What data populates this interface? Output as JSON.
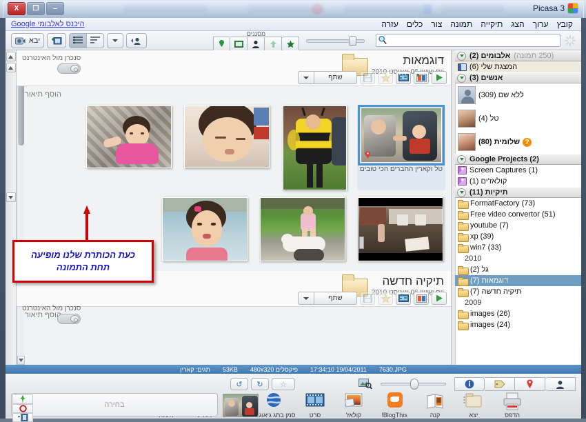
{
  "window": {
    "title": "Picasa 3",
    "buttons": {
      "close": "X",
      "maximize": "❐",
      "minimize": "–"
    }
  },
  "menubar": {
    "items": [
      "קובץ",
      "ערוך",
      "הצג",
      "תיקייה",
      "תמונה",
      "צור",
      "כלים",
      "עזרה"
    ],
    "google_link": "היכנס לאלבומי Google"
  },
  "toolbar": {
    "search_placeholder": "",
    "search_value": "",
    "filters_label": "מסננים",
    "filters": [
      "geotag-filter",
      "video-filter",
      "faces-filter",
      "upload-filter",
      "star-filter"
    ],
    "import_label": "יבא",
    "zoom_value": 72
  },
  "sidebar": {
    "groups": [
      {
        "title": "אלבומים (2)",
        "dim": "(250 תמונה)",
        "items": [
          {
            "label": "המצגת שלי (6)",
            "icon": "book-icon",
            "style": "alt"
          }
        ]
      },
      {
        "title": "אנשים (3)",
        "dim": "",
        "items": [
          {
            "label": "ללא שם (309)",
            "icon": "avatar-generic",
            "style": "person"
          },
          {
            "label": "טל (4)",
            "icon": "avatar-photo",
            "style": "person"
          },
          {
            "label": "שלומית (80)",
            "icon": "avatar-photo",
            "style": "person",
            "badge": "?"
          }
        ]
      },
      {
        "title": "Google Projects (2)",
        "dim": "",
        "items": [
          {
            "label": "Screen Captures (1)",
            "icon": "album-icon"
          },
          {
            "label": "קולאז'ים (1)",
            "icon": "album-icon"
          }
        ]
      },
      {
        "title": "תיקיות (11)",
        "dim": "",
        "items": [
          {
            "label": "FormatFactory (73)",
            "icon": "folder-icon"
          },
          {
            "label": "Free video convertor (51)",
            "icon": "folder-icon"
          },
          {
            "label": "youtube (7)",
            "icon": "folder-icon"
          },
          {
            "label": "xp (39)",
            "icon": "folder-icon"
          },
          {
            "label": "win7 (33)",
            "icon": "folder-icon"
          },
          {
            "label": "2010",
            "icon": "year-label",
            "style": "year"
          },
          {
            "label": "גל (2)",
            "icon": "folder-icon"
          },
          {
            "label": "דוגמאות (7)",
            "icon": "folder-icon",
            "style": "selected"
          },
          {
            "label": "תיקיה חדשה (7)",
            "icon": "folder-icon"
          },
          {
            "label": "2009",
            "icon": "year-label",
            "style": "year"
          },
          {
            "label": "images (26)",
            "icon": "folder-icon"
          },
          {
            "label": "images (24)",
            "icon": "folder-icon"
          }
        ]
      }
    ]
  },
  "albums": [
    {
      "name": "דוגמאות",
      "date": "יום שישי 06 אוגוסט 2010",
      "share_label": "שתף",
      "description_placeholder": "הוסף תיאור",
      "sync_label": "סנכרן מול האינטרנט",
      "photos": [
        {
          "caption": "טל וקארין החברים הכי טובים",
          "selected": true,
          "art": "stroller",
          "geotag": true,
          "w": 116,
          "h": 78
        },
        {
          "caption": "",
          "selected": false,
          "art": "bee",
          "w": 92,
          "h": 122
        },
        {
          "caption": "",
          "selected": false,
          "art": "sleep",
          "w": 124,
          "h": 90
        },
        {
          "caption": "",
          "selected": false,
          "art": "pink",
          "w": 124,
          "h": 91
        },
        {
          "caption": "",
          "selected": false,
          "art": "video",
          "w": 124,
          "h": 93
        },
        {
          "caption": "",
          "selected": false,
          "art": "cat",
          "w": 124,
          "h": 93
        },
        {
          "caption": "",
          "selected": false,
          "art": "pool",
          "w": 124,
          "h": 93
        }
      ]
    },
    {
      "name": "תיקיה חדשה",
      "date": "יום שישי 06 אוגוסט 2010",
      "share_label": "שתף",
      "description_placeholder": "הוסף תיאור",
      "sync_label": "סנכרן מול האינטרנט",
      "photos": []
    }
  ],
  "statusbar": {
    "filename": "7630.JPG",
    "datetime": "17:34:10 19/04/2011",
    "dimensions": "480x320 פיקסלים",
    "filesize": "53KB",
    "tags": "תגים: קארין"
  },
  "tray": {
    "info_buttons": [
      "info-icon",
      "tag-icon",
      "geotag-icon",
      "person-icon"
    ],
    "actions": [
      {
        "label": "הדפס",
        "icon": "printer-icon"
      },
      {
        "label": "יצא",
        "icon": "export-folder-icon"
      },
      {
        "label": "קנה",
        "icon": "buy-book-icon"
      },
      {
        "label": "BlogThis!",
        "icon": "blogger-icon"
      },
      {
        "label": "קולאז'",
        "icon": "collage-icon"
      },
      {
        "label": "סרט",
        "icon": "movie-icon"
      },
      {
        "label": "סמן בתג גיאוגרפי",
        "icon": "geotag-globe-icon"
      },
      {
        "label": "דוא\"ל",
        "icon": "email-icon"
      },
      {
        "label": "העלה",
        "icon": "upload-icon"
      }
    ],
    "selection_label": "בחירה",
    "undo_label": "↺",
    "redo_label": "↻",
    "star_label": "☆"
  },
  "annotation": {
    "line1": "כעת הכותרת שלנו מופיעה",
    "line2": "תחת התמונה",
    "border_color": "#cc0000",
    "text_color": "#1414c8"
  }
}
